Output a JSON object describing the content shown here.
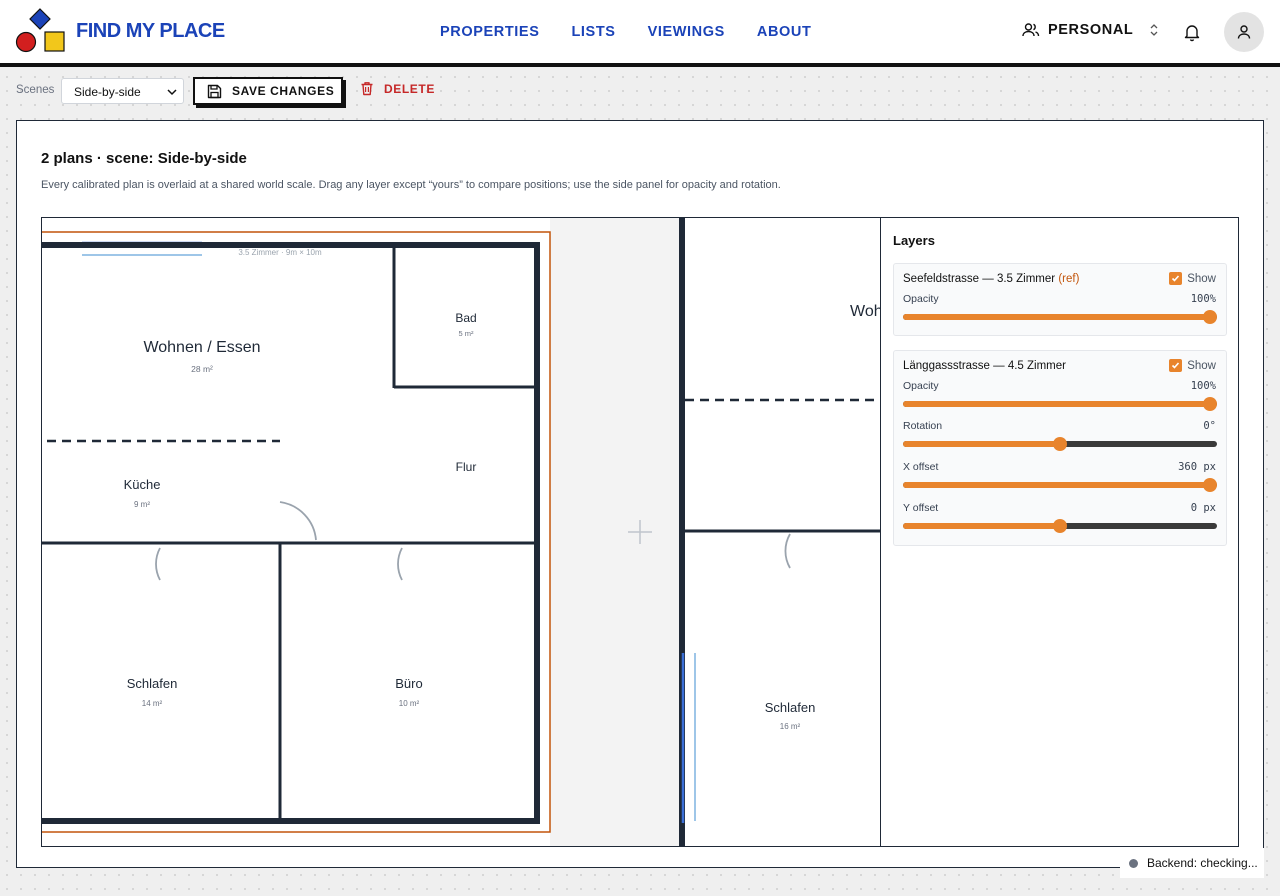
{
  "brand": {
    "name": "FIND MY PLACE",
    "logo_colors": {
      "diamond": "#1b43b8",
      "circle": "#d21f1f",
      "square": "#f2c71b"
    }
  },
  "nav": {
    "items": [
      {
        "label": "PROPERTIES"
      },
      {
        "label": "LISTS"
      },
      {
        "label": "VIEWINGS"
      },
      {
        "label": "ABOUT"
      }
    ],
    "color": "#1b43b8"
  },
  "workspace": {
    "label": "PERSONAL",
    "icon": "users-icon"
  },
  "toolbar": {
    "scenes_label": "Scenes",
    "scene_selected": "Side-by-side",
    "save_label": "SAVE CHANGES",
    "delete_label": "DELETE"
  },
  "scene": {
    "title": "2 plans · scene: Side-by-side",
    "description": "Every calibrated plan is overlaid at a shared world scale. Drag any layer except “yours” to compare positions; use the side panel for opacity and rotation."
  },
  "plans": {
    "plan1": {
      "caption": "3.5 Zimmer · 9m × 10m",
      "rooms": [
        {
          "name": "Wohnen / Essen",
          "area": "28 m²"
        },
        {
          "name": "Bad",
          "area": "5 m²"
        },
        {
          "name": "Küche",
          "area": "9 m²"
        },
        {
          "name": "Flur",
          "area": ""
        },
        {
          "name": "Schlafen",
          "area": "14 m²"
        },
        {
          "name": "Büro",
          "area": "10 m²"
        }
      ]
    },
    "plan2": {
      "rooms": [
        {
          "name": "Wohnen",
          "area": ""
        },
        {
          "name": "Schlafen",
          "area": "16 m²"
        }
      ]
    }
  },
  "layers": {
    "title": "Layers",
    "items": [
      {
        "name": "Seefeldstrasse — 3.5 Zimmer",
        "ref_tag": "(ref)",
        "show_label": "Show",
        "show": true,
        "controls": [
          {
            "label": "Opacity",
            "value": "100%",
            "fraction": 1.0
          }
        ]
      },
      {
        "name": "Länggassstrasse — 4.5 Zimmer",
        "ref_tag": "",
        "show_label": "Show",
        "show": true,
        "controls": [
          {
            "label": "Opacity",
            "value": "100%",
            "fraction": 1.0
          },
          {
            "label": "Rotation",
            "value": "0°",
            "fraction": 0.5
          },
          {
            "label": "X offset",
            "value": "360 px",
            "fraction": 1.0
          },
          {
            "label": "Y offset",
            "value": "0 px",
            "fraction": 0.5
          }
        ]
      }
    ],
    "accent": "#e8842c"
  },
  "status": {
    "backend": "Backend: checking..."
  }
}
